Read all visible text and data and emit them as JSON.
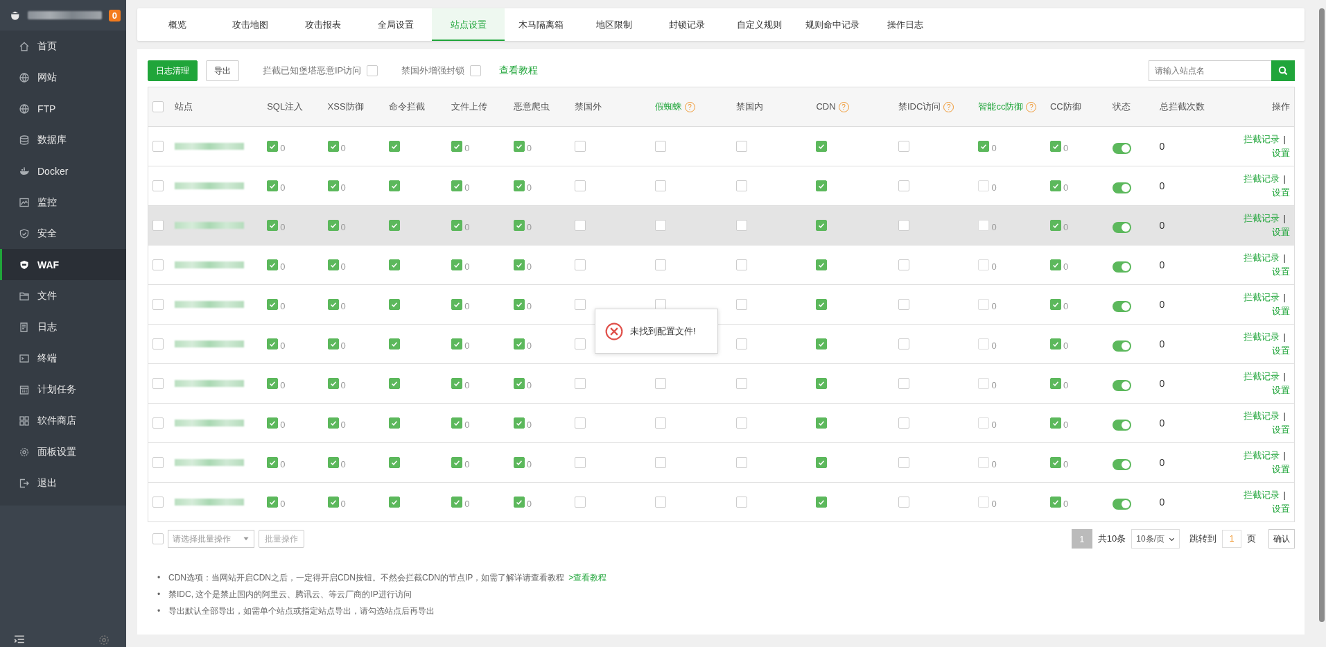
{
  "sidebar": {
    "badge": "0",
    "items": [
      {
        "label": "首页",
        "selected": false
      },
      {
        "label": "网站",
        "selected": false
      },
      {
        "label": "FTP",
        "selected": false
      },
      {
        "label": "数据库",
        "selected": false
      },
      {
        "label": "Docker",
        "selected": false
      },
      {
        "label": "监控",
        "selected": false
      },
      {
        "label": "安全",
        "selected": false
      },
      {
        "label": "WAF",
        "selected": true
      },
      {
        "label": "文件",
        "selected": false
      },
      {
        "label": "日志",
        "selected": false
      },
      {
        "label": "终端",
        "selected": false
      },
      {
        "label": "计划任务",
        "selected": false
      },
      {
        "label": "软件商店",
        "selected": false
      },
      {
        "label": "面板设置",
        "selected": false
      },
      {
        "label": "退出",
        "selected": false
      }
    ]
  },
  "tabs": [
    {
      "label": "概览",
      "selected": false
    },
    {
      "label": "攻击地图",
      "selected": false
    },
    {
      "label": "攻击报表",
      "selected": false
    },
    {
      "label": "全局设置",
      "selected": false
    },
    {
      "label": "站点设置",
      "selected": true
    },
    {
      "label": "木马隔离箱",
      "selected": false
    },
    {
      "label": "地区限制",
      "selected": false
    },
    {
      "label": "封锁记录",
      "selected": false
    },
    {
      "label": "自定义规则",
      "selected": false
    },
    {
      "label": "规则命中记录",
      "selected": false
    },
    {
      "label": "操作日志",
      "selected": false
    }
  ],
  "toolbar": {
    "buttons": [
      {
        "label": "日志清理",
        "kind": "primary"
      },
      {
        "label": "导出",
        "kind": "default"
      }
    ],
    "options": [
      {
        "label": "拦截已知堡塔恶意IP访问",
        "checked": false
      },
      {
        "label": "禁国外增强封锁",
        "checked": false
      }
    ],
    "link": "查看教程",
    "search": {
      "placeholder": "请输入站点名"
    }
  },
  "table": {
    "select_all": false,
    "columns": [
      {
        "label": "站点",
        "kind": "site",
        "accent": false
      },
      {
        "label": "SQL注入",
        "kind": "check",
        "accent": false
      },
      {
        "label": "XSS防御",
        "kind": "check",
        "accent": false
      },
      {
        "label": "命令拦截",
        "kind": "check",
        "accent": false
      },
      {
        "label": "文件上传",
        "kind": "check",
        "accent": false
      },
      {
        "label": "恶意爬虫",
        "kind": "check",
        "accent": false
      },
      {
        "label": "禁国外",
        "kind": "check",
        "accent": false
      },
      {
        "label": "假蜘蛛",
        "kind": "check",
        "accent": true,
        "help": "?"
      },
      {
        "label": "禁国内",
        "kind": "check",
        "accent": false
      },
      {
        "label": "CDN",
        "kind": "check",
        "accent": false,
        "help": "?"
      },
      {
        "label": "禁IDC访问",
        "kind": "check",
        "accent": false,
        "help": "?"
      },
      {
        "label": "智能cc防御",
        "kind": "check",
        "accent": true,
        "help": "?"
      },
      {
        "label": "CC防御",
        "kind": "check",
        "accent": false
      },
      {
        "label": "状态",
        "kind": "switch",
        "accent": false
      },
      {
        "label": "总拦截次数",
        "kind": "total",
        "accent": false
      },
      {
        "label": "操作",
        "kind": "actions",
        "accent": false
      }
    ],
    "rows": [
      {
        "selected": false,
        "hovered": false,
        "checks": [
          {
            "checked": true,
            "count": "0"
          },
          {
            "checked": true,
            "count": "0"
          },
          {
            "checked": true
          },
          {
            "checked": true,
            "count": "0"
          },
          {
            "checked": true,
            "count": "0"
          },
          {
            "checked": false
          },
          {
            "checked": false
          },
          {
            "checked": false
          },
          {
            "checked": true
          },
          {
            "checked": false
          },
          {
            "checked": true,
            "count": "0"
          },
          {
            "checked": true,
            "count": "0"
          }
        ],
        "on": true,
        "total": "0",
        "actions": {
          "links": [
            "拦截记录",
            "设置"
          ],
          "separator": "|"
        }
      },
      {
        "selected": false,
        "hovered": false,
        "checks": [
          {
            "checked": true,
            "count": "0"
          },
          {
            "checked": true,
            "count": "0"
          },
          {
            "checked": true
          },
          {
            "checked": true,
            "count": "0"
          },
          {
            "checked": true,
            "count": "0"
          },
          {
            "checked": false
          },
          {
            "checked": false
          },
          {
            "checked": false
          },
          {
            "checked": true
          },
          {
            "checked": false
          },
          {
            "checked": false,
            "count": "0"
          },
          {
            "checked": true,
            "count": "0"
          }
        ],
        "on": true,
        "total": "0",
        "actions": {
          "links": [
            "拦截记录",
            "设置"
          ],
          "separator": "|"
        }
      },
      {
        "selected": false,
        "hovered": true,
        "checks": [
          {
            "checked": true,
            "count": "0"
          },
          {
            "checked": true,
            "count": "0"
          },
          {
            "checked": true
          },
          {
            "checked": true,
            "count": "0"
          },
          {
            "checked": true,
            "count": "0"
          },
          {
            "checked": false
          },
          {
            "checked": false
          },
          {
            "checked": false
          },
          {
            "checked": true
          },
          {
            "checked": false
          },
          {
            "checked": false,
            "count": "0"
          },
          {
            "checked": true,
            "count": "0"
          }
        ],
        "on": true,
        "total": "0",
        "actions": {
          "links": [
            "拦截记录",
            "设置"
          ],
          "separator": "|"
        }
      },
      {
        "selected": false,
        "hovered": false,
        "checks": [
          {
            "checked": true,
            "count": "0"
          },
          {
            "checked": true,
            "count": "0"
          },
          {
            "checked": true
          },
          {
            "checked": true,
            "count": "0"
          },
          {
            "checked": true,
            "count": "0"
          },
          {
            "checked": false
          },
          {
            "checked": false
          },
          {
            "checked": false
          },
          {
            "checked": true
          },
          {
            "checked": false
          },
          {
            "checked": false,
            "count": "0"
          },
          {
            "checked": true,
            "count": "0"
          }
        ],
        "on": true,
        "total": "0",
        "actions": {
          "links": [
            "拦截记录",
            "设置"
          ],
          "separator": "|"
        }
      },
      {
        "selected": false,
        "hovered": false,
        "checks": [
          {
            "checked": true,
            "count": "0"
          },
          {
            "checked": true,
            "count": "0"
          },
          {
            "checked": true
          },
          {
            "checked": true,
            "count": "0"
          },
          {
            "checked": true,
            "count": "0"
          },
          {
            "checked": false
          },
          {
            "checked": false
          },
          {
            "checked": false
          },
          {
            "checked": true
          },
          {
            "checked": false
          },
          {
            "checked": false,
            "count": "0"
          },
          {
            "checked": true,
            "count": "0"
          }
        ],
        "on": true,
        "total": "0",
        "actions": {
          "links": [
            "拦截记录",
            "设置"
          ],
          "separator": "|"
        }
      },
      {
        "selected": false,
        "hovered": false,
        "checks": [
          {
            "checked": true,
            "count": "0"
          },
          {
            "checked": true,
            "count": "0"
          },
          {
            "checked": true
          },
          {
            "checked": true,
            "count": "0"
          },
          {
            "checked": true,
            "count": "0"
          },
          {
            "checked": false
          },
          {
            "covered": true
          },
          {
            "checked": false
          },
          {
            "checked": true
          },
          {
            "checked": false
          },
          {
            "checked": false,
            "count": "0"
          },
          {
            "checked": true,
            "count": "0"
          }
        ],
        "on": true,
        "total": "0",
        "actions": {
          "links": [
            "拦截记录",
            "设置"
          ],
          "separator": "|"
        }
      },
      {
        "selected": false,
        "hovered": false,
        "checks": [
          {
            "checked": true,
            "count": "0"
          },
          {
            "checked": true,
            "count": "0"
          },
          {
            "checked": true
          },
          {
            "checked": true,
            "count": "0"
          },
          {
            "checked": true,
            "count": "0"
          },
          {
            "checked": false
          },
          {
            "checked": false
          },
          {
            "checked": false
          },
          {
            "checked": true
          },
          {
            "checked": false
          },
          {
            "checked": false,
            "count": "0"
          },
          {
            "checked": true,
            "count": "0"
          }
        ],
        "on": true,
        "total": "0",
        "actions": {
          "links": [
            "拦截记录",
            "设置"
          ],
          "separator": "|"
        }
      },
      {
        "selected": false,
        "hovered": false,
        "checks": [
          {
            "checked": true,
            "count": "0"
          },
          {
            "checked": true,
            "count": "0"
          },
          {
            "checked": true
          },
          {
            "checked": true,
            "count": "0"
          },
          {
            "checked": true,
            "count": "0"
          },
          {
            "checked": false
          },
          {
            "checked": false
          },
          {
            "checked": false
          },
          {
            "checked": true
          },
          {
            "checked": false
          },
          {
            "checked": false,
            "count": "0"
          },
          {
            "checked": true,
            "count": "0"
          }
        ],
        "on": true,
        "total": "0",
        "actions": {
          "links": [
            "拦截记录",
            "设置"
          ],
          "separator": "|"
        }
      },
      {
        "selected": false,
        "hovered": false,
        "checks": [
          {
            "checked": true,
            "count": "0"
          },
          {
            "checked": true,
            "count": "0"
          },
          {
            "checked": true
          },
          {
            "checked": true,
            "count": "0"
          },
          {
            "checked": true,
            "count": "0"
          },
          {
            "checked": false
          },
          {
            "checked": false
          },
          {
            "checked": false
          },
          {
            "checked": true
          },
          {
            "checked": false
          },
          {
            "checked": false,
            "count": "0"
          },
          {
            "checked": true,
            "count": "0"
          }
        ],
        "on": true,
        "total": "0",
        "actions": {
          "links": [
            "拦截记录",
            "设置"
          ],
          "separator": "|"
        }
      },
      {
        "selected": false,
        "hovered": false,
        "checks": [
          {
            "checked": true,
            "count": "0"
          },
          {
            "checked": true,
            "count": "0"
          },
          {
            "checked": true
          },
          {
            "checked": true,
            "count": "0"
          },
          {
            "checked": true,
            "count": "0"
          },
          {
            "checked": false
          },
          {
            "checked": false
          },
          {
            "checked": false
          },
          {
            "checked": true
          },
          {
            "checked": false
          },
          {
            "checked": false,
            "count": "0"
          },
          {
            "checked": true,
            "count": "0"
          }
        ],
        "on": true,
        "total": "0",
        "actions": {
          "links": [
            "拦截记录",
            "设置"
          ],
          "separator": "|"
        }
      }
    ]
  },
  "footer": {
    "batch_all": false,
    "batch_placeholder": "请选择批量操作",
    "batch_button": "批量操作",
    "page": "1",
    "total": "共10条",
    "page_size": "10条/页",
    "jump_label": "跳转到",
    "jump_value": "1",
    "page_unit": "页",
    "confirm": "确认"
  },
  "notes": [
    {
      "bullet": "•",
      "text": "CDN选项：当网站开启CDN之后，一定得开启CDN按钮。不然会拦截CDN的节点IP，如需了解详请查看教程",
      "link": ">查看教程"
    },
    {
      "bullet": "•",
      "text": "禁IDC, 这个是禁止国内的阿里云、腾讯云、等云厂商的IP进行访问"
    },
    {
      "bullet": "•",
      "text": "导出默认全部导出，如需单个站点或指定站点导出，请勾选站点后再导出"
    }
  ],
  "toast": {
    "kind": "error",
    "message": "未找到配置文件!"
  }
}
